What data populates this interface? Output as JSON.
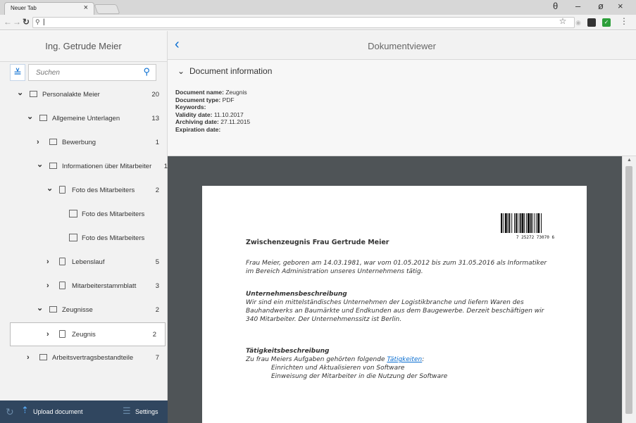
{
  "browser": {
    "tab_title": "Neuer Tab",
    "tab_close": "×",
    "address_value": "|",
    "win_min": "–",
    "win_max": "ø",
    "win_close": "×",
    "profile_icon": "θ"
  },
  "left": {
    "header": "Ing. Getrude Meier",
    "search_placeholder": "Suchen",
    "tree": [
      {
        "label": "Personalakte Meier",
        "count": "20",
        "expanded": true,
        "indent": 0
      },
      {
        "label": "Allgemeine Unterlagen",
        "count": "13",
        "expanded": true,
        "indent": 1
      },
      {
        "label": "Bewerbung",
        "count": "1",
        "expanded": false,
        "indent": 2
      },
      {
        "label": "Informationen über Mitarbeiter",
        "count": "1",
        "expanded": true,
        "indent": 2
      },
      {
        "label": "Foto des Mitarbeiters",
        "count": "2",
        "expanded": true,
        "indent": 3
      },
      {
        "label": "Foto des Mitarbeiters",
        "count": "",
        "leaf": true,
        "indent": 4
      },
      {
        "label": "Foto des Mitarbeiters",
        "count": "",
        "leaf": true,
        "indent": 4
      },
      {
        "label": "Lebenslauf",
        "count": "5",
        "expanded": false,
        "indent": 3
      },
      {
        "label": "Mitarbeiterstammblatt",
        "count": "3",
        "expanded": false,
        "indent": 3
      },
      {
        "label": "Zeugnisse",
        "count": "2",
        "expanded": true,
        "indent": 2
      },
      {
        "label": "Zeugnis",
        "count": "2",
        "expanded": false,
        "indent": 3,
        "selected": true
      },
      {
        "label": "Arbeitsvertragsbestandteile",
        "count": "7",
        "expanded": false,
        "indent": 1
      }
    ],
    "footer": {
      "upload_label": "Upload document",
      "settings_label": "Settings"
    }
  },
  "right": {
    "title": "Dokumentviewer",
    "info_title": "Document information",
    "info": {
      "name_key": "Document name:",
      "name_val": "Zeugnis",
      "type_key": "Document type:",
      "type_val": "PDF",
      "keywords_key": "Keywords:",
      "validity_key": "Validity date:",
      "validity_val": "11.10.2017",
      "archiving_key": "Archiving date:",
      "archiving_val": "27.11.2015",
      "expiration_key": "Expiration date:"
    },
    "document": {
      "barcode_text": "7 25272 73070 6",
      "title": "Zwischenzeugnis Frau Gertrude Meier",
      "intro": "Frau Meier, geboren am 14.03.1981, war vom 01.05.2012 bis zum 31.05.2016 als Informatiker im Bereich Administration unseres Unternehmens tätig.",
      "h1": "Unternehmensbeschreibung",
      "p1": "Wir sind ein mittelständisches Unternehmen der Logistikbranche und liefern Waren des Bauhandwerks an Baumärkte und Endkunden aus dem Baugewerbe. Derzeit beschäftigen wir 340 Mitarbeiter. Der Unternehmenssitz ist Berlin.",
      "h2": "Tätigkeitsbeschreibung",
      "p2_prefix": "Zu frau Meiers Aufgaben gehörten folgende ",
      "p2_link": "Tätigkeiten",
      "p2_suffix": ":",
      "task1": "Einrichten und Aktualisieren von Software",
      "task2": "Einweisung der Mitarbeiter in die Nutzung der Software"
    }
  }
}
